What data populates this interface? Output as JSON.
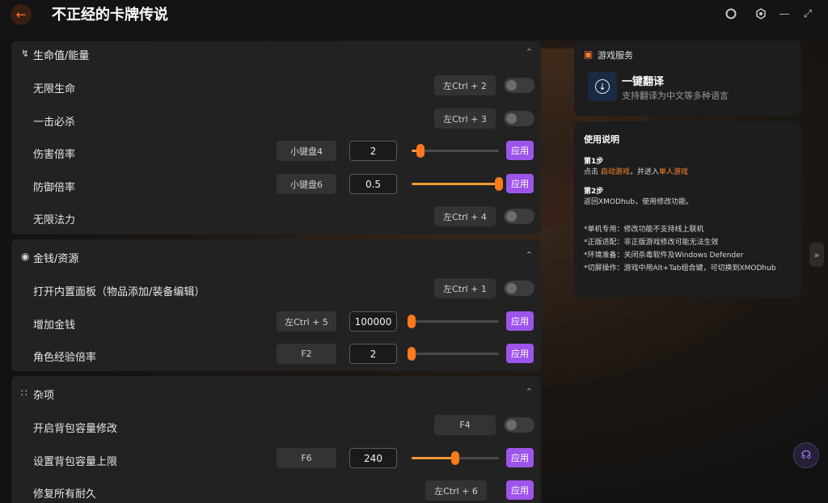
{
  "app": {
    "title": "不正经的卡牌传说",
    "back_icon": "arrow-left-icon",
    "accent": "#ff7a2e",
    "apply_color": "#9d54ea"
  },
  "sections": {
    "health": {
      "title": "生命值/能量",
      "rows": [
        {
          "label": "无限生命",
          "hotkey": "左Ctrl + 2"
        },
        {
          "label": "一击必杀",
          "hotkey": "左Ctrl + 3"
        },
        {
          "label": "伤害倍率",
          "hotkey": "小键盘4",
          "value": "2",
          "apply": "应用",
          "level": 0.1
        },
        {
          "label": "防御倍率",
          "hotkey": "小键盘6",
          "value": "0.5",
          "apply": "应用",
          "level": 1.0
        },
        {
          "label": "无限法力",
          "hotkey": "左Ctrl + 4"
        }
      ]
    },
    "money": {
      "title": "金钱/资源",
      "rows": [
        {
          "label": "打开内置面板（物品添加/装备编辑）",
          "hotkey": "左Ctrl + 1"
        },
        {
          "label": "增加金钱",
          "hotkey": "左Ctrl + 5",
          "value": "100000",
          "apply": "应用",
          "level": 0.0
        },
        {
          "label": "角色经验倍率",
          "hotkey": "F2",
          "value": "2",
          "apply": "应用",
          "level": 0.0
        }
      ]
    },
    "misc": {
      "title": "杂项",
      "rows": [
        {
          "label": "开启背包容量修改",
          "hotkey": "F4"
        },
        {
          "label": "设置背包容量上限",
          "hotkey": "F6",
          "value": "240",
          "apply": "应用",
          "level": 0.5
        },
        {
          "label": "修复所有耐久",
          "hotkey": "左Ctrl + 6",
          "apply": "应用"
        }
      ]
    }
  },
  "service": {
    "title": "游戏服务",
    "translate_title": "一键翻译",
    "translate_sub": "支持翻译为中文等多种语言"
  },
  "help": {
    "title": "使用说明",
    "step1_title": "第1步",
    "step1_a": "点击 ",
    "step1_link1": "启动游戏",
    "step1_b": "，并进入",
    "step1_link2": "单人游戏",
    "step2_title": "第2步",
    "step2_text": "返回XMODhub，使用修改功能。",
    "notes": [
      "*单机专用：修改功能不支持线上联机",
      "*正版适配：非正版游戏修改可能无法生效",
      "*环境准备：关闭杀毒软件及Windows Defender",
      "*切屏操作：游戏中用Alt+Tab组合键，可切换到XMODhub"
    ]
  }
}
